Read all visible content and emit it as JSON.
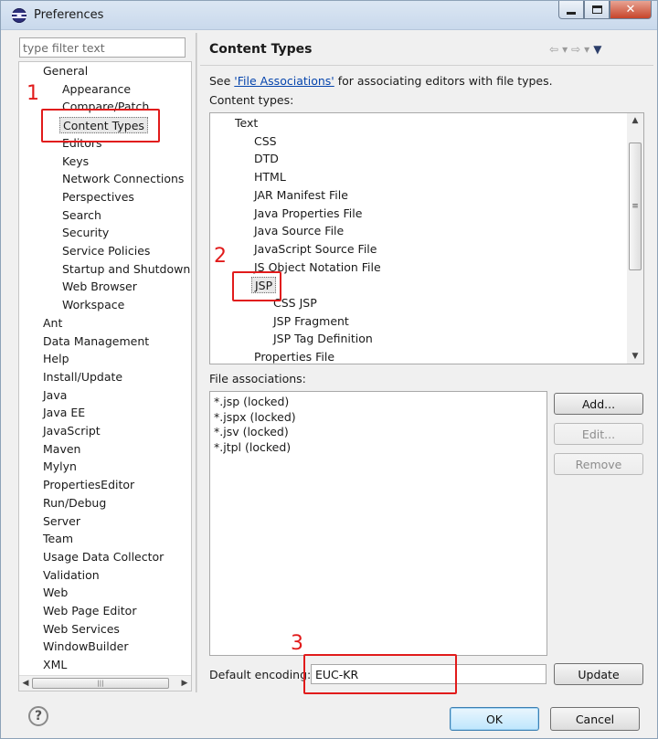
{
  "window": {
    "title": "Preferences",
    "icon": "eclipse-icon",
    "controls": {
      "minimize": "minimize-icon",
      "maximize": "maximize-icon",
      "close": "✕"
    }
  },
  "filter": {
    "placeholder": "type filter text"
  },
  "tree": {
    "items": [
      {
        "label": "General",
        "level": 0
      },
      {
        "label": "Appearance",
        "level": 1
      },
      {
        "label": "Compare/Patch",
        "level": 1
      },
      {
        "label": "Content Types",
        "level": 1,
        "selected": true
      },
      {
        "label": "Editors",
        "level": 1
      },
      {
        "label": "Keys",
        "level": 1
      },
      {
        "label": "Network Connections",
        "level": 1
      },
      {
        "label": "Perspectives",
        "level": 1
      },
      {
        "label": "Search",
        "level": 1
      },
      {
        "label": "Security",
        "level": 1
      },
      {
        "label": "Service Policies",
        "level": 1
      },
      {
        "label": "Startup and Shutdown",
        "level": 1
      },
      {
        "label": "Web Browser",
        "level": 1
      },
      {
        "label": "Workspace",
        "level": 1
      },
      {
        "label": "Ant",
        "level": 0
      },
      {
        "label": "Data Management",
        "level": 0
      },
      {
        "label": "Help",
        "level": 0
      },
      {
        "label": "Install/Update",
        "level": 0
      },
      {
        "label": "Java",
        "level": 0
      },
      {
        "label": "Java EE",
        "level": 0
      },
      {
        "label": "JavaScript",
        "level": 0
      },
      {
        "label": "Maven",
        "level": 0
      },
      {
        "label": "Mylyn",
        "level": 0
      },
      {
        "label": "PropertiesEditor",
        "level": 0
      },
      {
        "label": "Run/Debug",
        "level": 0
      },
      {
        "label": "Server",
        "level": 0
      },
      {
        "label": "Team",
        "level": 0
      },
      {
        "label": "Usage Data Collector",
        "level": 0
      },
      {
        "label": "Validation",
        "level": 0
      },
      {
        "label": "Web",
        "level": 0
      },
      {
        "label": "Web Page Editor",
        "level": 0
      },
      {
        "label": "Web Services",
        "level": 0
      },
      {
        "label": "WindowBuilder",
        "level": 0
      },
      {
        "label": "XML",
        "level": 0
      }
    ]
  },
  "page": {
    "title": "Content Types",
    "desc_pre": "See ",
    "desc_link": "'File Associations'",
    "desc_post": " for associating editors with file types.",
    "content_types_label": "Content types:",
    "file_assoc_label": "File associations:",
    "encoding_label": "Default encoding:",
    "encoding_value": "EUC-KR"
  },
  "content_types": [
    {
      "label": "Text",
      "level": 0
    },
    {
      "label": "CSS",
      "level": 1
    },
    {
      "label": "DTD",
      "level": 1
    },
    {
      "label": "HTML",
      "level": 1
    },
    {
      "label": "JAR Manifest File",
      "level": 1
    },
    {
      "label": "Java Properties File",
      "level": 1
    },
    {
      "label": "Java Source File",
      "level": 1
    },
    {
      "label": "JavaScript Source File",
      "level": 1
    },
    {
      "label": "JS Object Notation File",
      "level": 1
    },
    {
      "label": "JSP",
      "level": 1,
      "selected": true
    },
    {
      "label": "CSS JSP",
      "level": 2
    },
    {
      "label": "JSP Fragment",
      "level": 2
    },
    {
      "label": "JSP Tag Definition",
      "level": 2
    },
    {
      "label": "Properties File",
      "level": 1
    }
  ],
  "file_associations": [
    "*.jsp (locked)",
    "*.jspx (locked)",
    "*.jsv (locked)",
    "*.jtpl (locked)"
  ],
  "buttons": {
    "add": "Add...",
    "edit": "Edit...",
    "remove": "Remove",
    "update": "Update",
    "ok": "OK",
    "cancel": "Cancel",
    "help": "?"
  },
  "annotations": [
    "1",
    "2",
    "3"
  ],
  "colors": {
    "annotation": "#e11b1b",
    "link": "#0645ad"
  }
}
